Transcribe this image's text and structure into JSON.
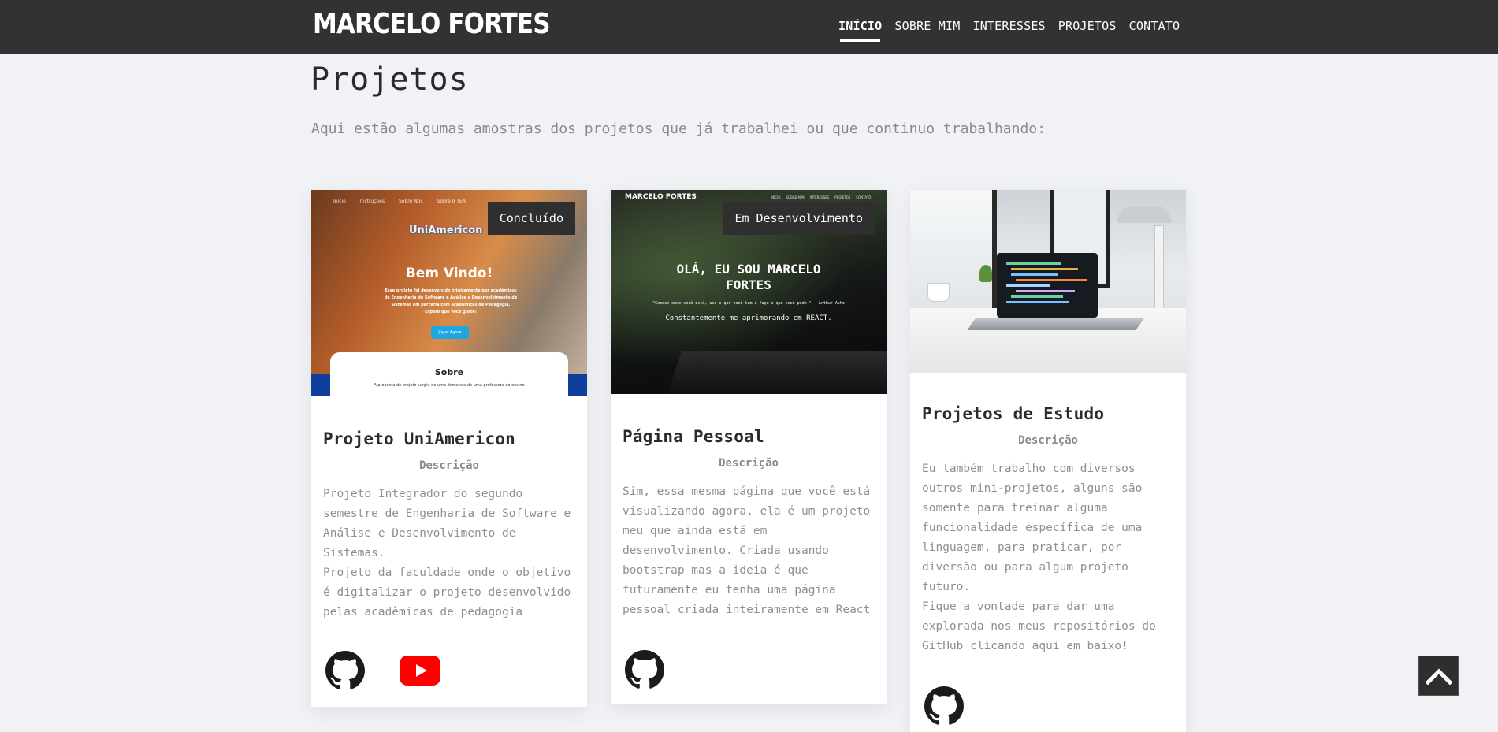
{
  "brand": "MARCELO FORTES",
  "nav": [
    {
      "label": "INÍCIO",
      "active": true
    },
    {
      "label": "SOBRE MIM",
      "active": false
    },
    {
      "label": "INTERESSES",
      "active": false
    },
    {
      "label": "PROJETOS",
      "active": false
    },
    {
      "label": "CONTATO",
      "active": false
    }
  ],
  "section": {
    "title": "Projetos",
    "intro": "Aqui estão algumas amostras dos projetos que já trabalhei ou que continuo trabalhando:"
  },
  "cards": [
    {
      "status": "Concluído",
      "title": "Projeto UniAmericon",
      "subtitle": "Descrição",
      "text": [
        "Projeto Integrador do segundo semestre de Engenharia de Software e Análise e Desenvolvimento de Sistemas.",
        "Projeto da faculdade onde o objetivo é digitalizar o projeto desenvolvido pelas acadêmicas de pedagogia"
      ],
      "image": {
        "nav": [
          "Início",
          "Instruções",
          "Sobre Nós",
          "Sobre o TEA"
        ],
        "logo": "UniAmericon",
        "heading": "Bem Vindo!",
        "body": "Esse projeto foi desenvolvido inteiramente por acadêmicos de Engenharia de Software e Análise e Desenvolvimento de Sistemas em parceria com acadêmicas de Pedagogia. Espero que você goste!",
        "button": "Jogar Agora",
        "panel_title": "Sobre",
        "panel_text": "A proposta do projeto surgiu de uma demanda de uma professora do ensino"
      },
      "icons": [
        "github-icon",
        "youtube-icon"
      ]
    },
    {
      "status": "Em Desenvolvimento",
      "title": "Página Pessoal",
      "subtitle": "Descrição",
      "text": [
        "Sim, essa mesma página que você está visualizando agora, ela é um projeto meu que ainda está em desenvolvimento. Criada usando bootstrap mas a ideia é que futuramente eu tenha uma página pessoal criada inteiramente em React"
      ],
      "image": {
        "brand": "MARCELO FORTES",
        "nav": [
          "INÍCIO",
          "SOBRE MIM",
          "INTERESSES",
          "PROJETOS",
          "CONTATO"
        ],
        "heading": "OLÁ, EU SOU MARCELO FORTES",
        "quote": "\"Comece onde você está, use o que você tem e faça o que você pode.\" - Arthur Ashe",
        "tagline": "Constantemente me aprimorando em REACT."
      },
      "icons": [
        "github-icon"
      ]
    },
    {
      "status": "",
      "title": "Projetos de Estudo",
      "subtitle": "Descrição",
      "text": [
        "Eu também trabalho com diversos outros mini-projetos, alguns são somente para treinar alguma funcionalidade específica de uma linguagem, para praticar, por diversão ou para algum projeto futuro.",
        "Fique a vontade para dar uma explorada nos meus repositórios do GitHub clicando aqui em baixo!"
      ],
      "icons": [
        "github-icon"
      ]
    }
  ],
  "colors": {
    "navbar": "#323232",
    "background": "#f1f2f5",
    "youtube": "#ff0000",
    "muted_text": "#8f8f8f"
  },
  "back_to_top_icon": "chevron-up-icon"
}
